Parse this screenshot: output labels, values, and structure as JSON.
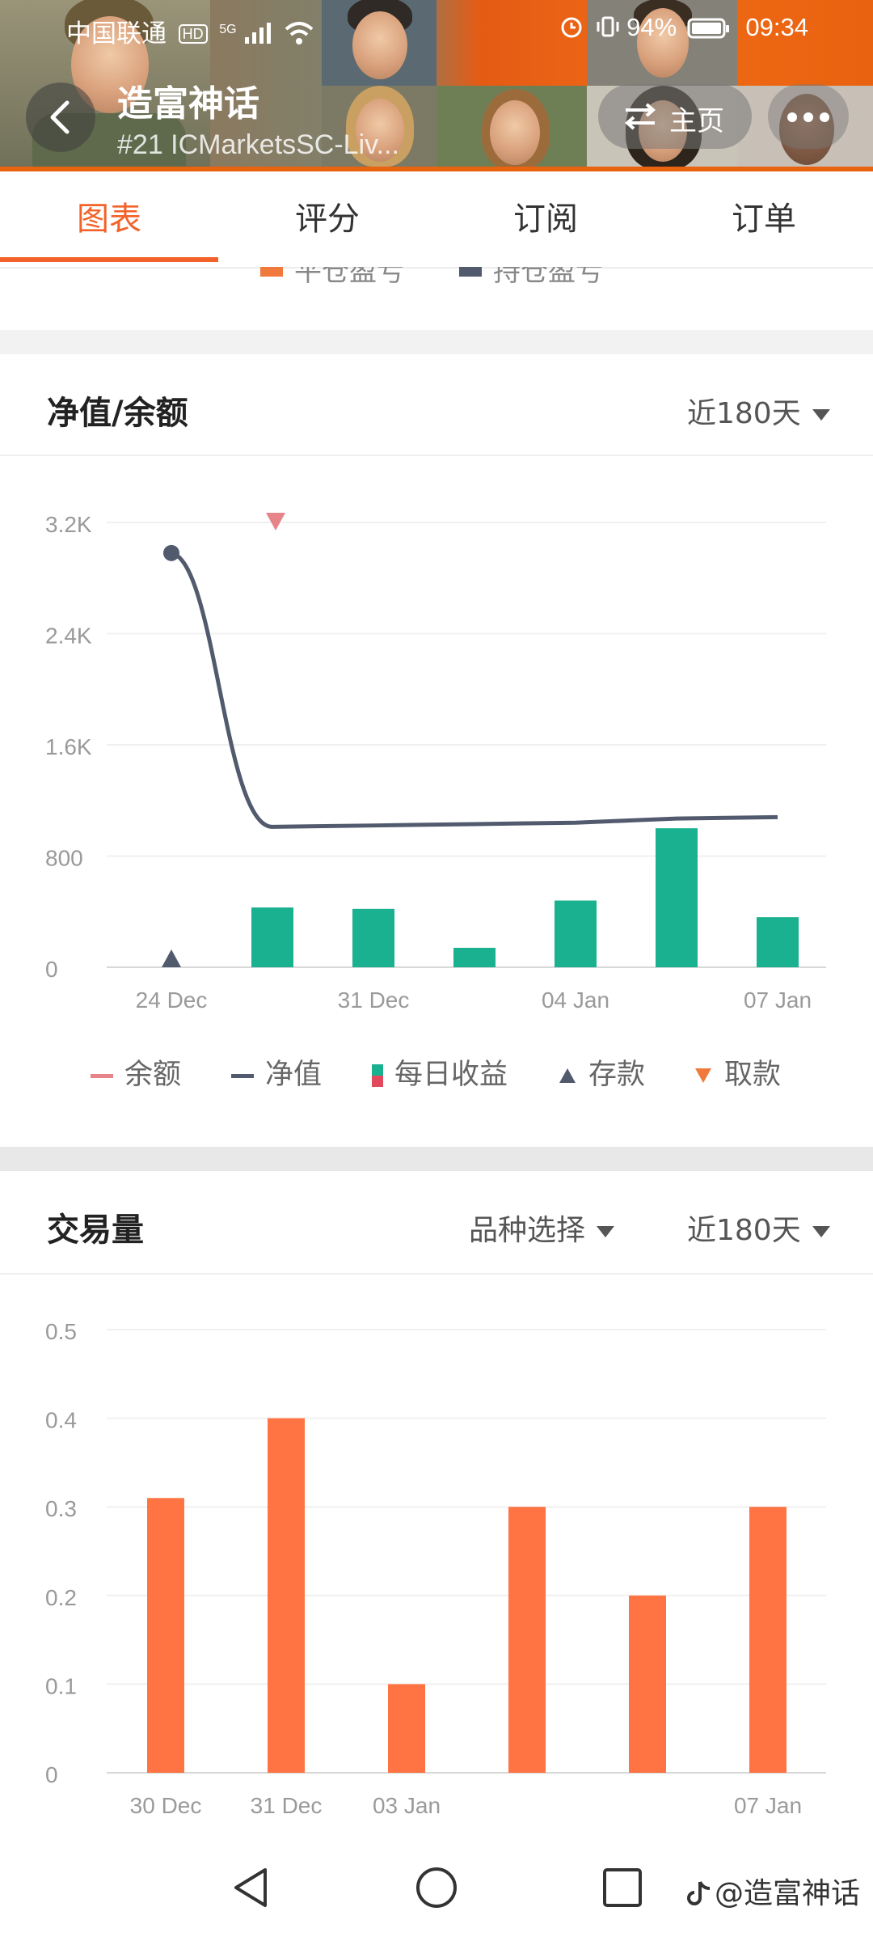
{
  "status_bar": {
    "carrier": "中国联通",
    "hd_badge": "HD",
    "net_type": "5G",
    "battery": "94%",
    "time": "09:34"
  },
  "header": {
    "title": "造富神话",
    "subtitle": "#21 ICMarketsSC-Liv...",
    "home_label": "主页"
  },
  "tabs": [
    "图表",
    "评分",
    "订阅",
    "订单"
  ],
  "top_legend_peek": [
    "平仓盈亏",
    "持仓盈亏"
  ],
  "equity_card": {
    "title": "净值/余额",
    "range_label": "近180天",
    "legend": [
      {
        "label": "余额",
        "color": "#e6848a"
      },
      {
        "label": "净值",
        "color": "#525a6e"
      },
      {
        "label": "每日收益",
        "color": "#19b18f"
      },
      {
        "label": "存款",
        "color": "#525a6e"
      },
      {
        "label": "取款",
        "color": "#f07a3c"
      }
    ]
  },
  "volume_card": {
    "title": "交易量",
    "filter_label": "品种选择",
    "range_label": "近180天"
  },
  "chart_data": [
    {
      "type": "bar",
      "y_tick_labels": [
        "0",
        "800",
        "1.6K",
        "2.4K",
        "3.2K"
      ],
      "ylim": [
        0,
        3200
      ],
      "x_tick_labels": [
        "24 Dec",
        "31 Dec",
        "04 Jan",
        "07 Jan"
      ],
      "series": [
        {
          "name": "净值",
          "kind": "line",
          "color": "#525a6e",
          "x": [
            0,
            1,
            2,
            3,
            4,
            5,
            6
          ],
          "values": [
            2980,
            1010,
            1020,
            1030,
            1040,
            1070,
            1080
          ]
        },
        {
          "name": "每日收益",
          "kind": "bar",
          "color": "#19b18f",
          "x": [
            1,
            2,
            3,
            4,
            5,
            6
          ],
          "values": [
            430,
            420,
            140,
            480,
            1000,
            360
          ]
        },
        {
          "name": "存款",
          "kind": "marker-up",
          "color": "#525a6e",
          "x": [
            0
          ],
          "values": [
            0
          ]
        },
        {
          "name": "取款",
          "kind": "marker-down",
          "color": "#e6848a",
          "x": [
            1
          ],
          "values": [
            3200
          ]
        }
      ],
      "grid": true
    },
    {
      "type": "bar",
      "y_tick_labels": [
        "0",
        "0.1",
        "0.2",
        "0.3",
        "0.4",
        "0.5"
      ],
      "ylim": [
        0,
        0.5
      ],
      "x_tick_labels": [
        "30 Dec",
        "31 Dec",
        "03 Jan",
        "07 Jan"
      ],
      "series": [
        {
          "color": "#ff7442",
          "values": [
            0.31,
            0.4,
            0.1,
            0.3,
            0.2,
            0.3
          ]
        }
      ],
      "grid": true
    }
  ],
  "nav_bar": [
    "back",
    "home",
    "recents"
  ],
  "watermark": "@造富神话"
}
